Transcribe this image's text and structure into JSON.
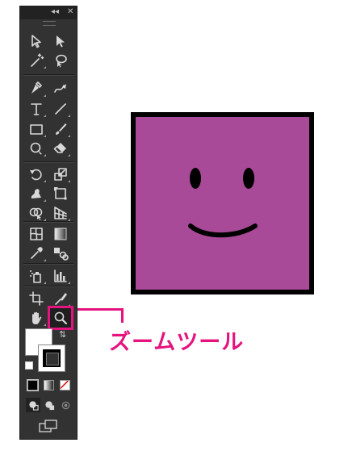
{
  "toolbar": {
    "panel_controls": {
      "collapse": "◂◂",
      "close": "✕"
    },
    "tools": [
      {
        "name": "selection-tool",
        "icon": "selection-arrow-icon"
      },
      {
        "name": "direct-selection-tool",
        "icon": "direct-selection-arrow-icon"
      },
      {
        "name": "magic-wand-tool",
        "icon": "magic-wand-icon"
      },
      {
        "name": "lasso-tool",
        "icon": "lasso-icon"
      },
      {
        "name": "pen-tool",
        "icon": "pen-icon"
      },
      {
        "name": "curvature-tool",
        "icon": "curvature-pen-icon"
      },
      {
        "name": "type-tool",
        "icon": "type-icon"
      },
      {
        "name": "line-segment-tool",
        "icon": "line-icon"
      },
      {
        "name": "rectangle-tool",
        "icon": "rectangle-icon"
      },
      {
        "name": "paintbrush-tool",
        "icon": "paintbrush-icon"
      },
      {
        "name": "shaper-tool",
        "icon": "shaper-icon"
      },
      {
        "name": "eraser-tool",
        "icon": "eraser-icon"
      },
      {
        "name": "rotate-tool",
        "icon": "rotate-icon"
      },
      {
        "name": "scale-tool",
        "icon": "scale-icon"
      },
      {
        "name": "warp-tool",
        "icon": "warp-icon"
      },
      {
        "name": "free-transform-tool",
        "icon": "free-transform-icon"
      },
      {
        "name": "shape-builder-tool",
        "icon": "shape-builder-icon"
      },
      {
        "name": "perspective-grid-tool",
        "icon": "perspective-grid-icon"
      },
      {
        "name": "mesh-tool",
        "icon": "mesh-icon"
      },
      {
        "name": "gradient-tool",
        "icon": "gradient-icon"
      },
      {
        "name": "eyedropper-tool",
        "icon": "eyedropper-icon"
      },
      {
        "name": "blend-tool",
        "icon": "blend-icon"
      },
      {
        "name": "symbol-sprayer-tool",
        "icon": "symbol-sprayer-icon"
      },
      {
        "name": "column-graph-tool",
        "icon": "column-graph-icon"
      },
      {
        "name": "artboard-tool",
        "icon": "artboard-icon"
      },
      {
        "name": "slice-tool",
        "icon": "slice-icon"
      },
      {
        "name": "hand-tool",
        "icon": "hand-icon"
      },
      {
        "name": "zoom-tool",
        "icon": "zoom-magnifier-icon",
        "selected": true
      }
    ],
    "fill_color": "#ffffff",
    "stroke_color": "#000000"
  },
  "callout": {
    "label": "ズームツール",
    "color": "#e5137e"
  },
  "artwork": {
    "fill_color": "#a84a97",
    "stroke_color": "#000000"
  }
}
